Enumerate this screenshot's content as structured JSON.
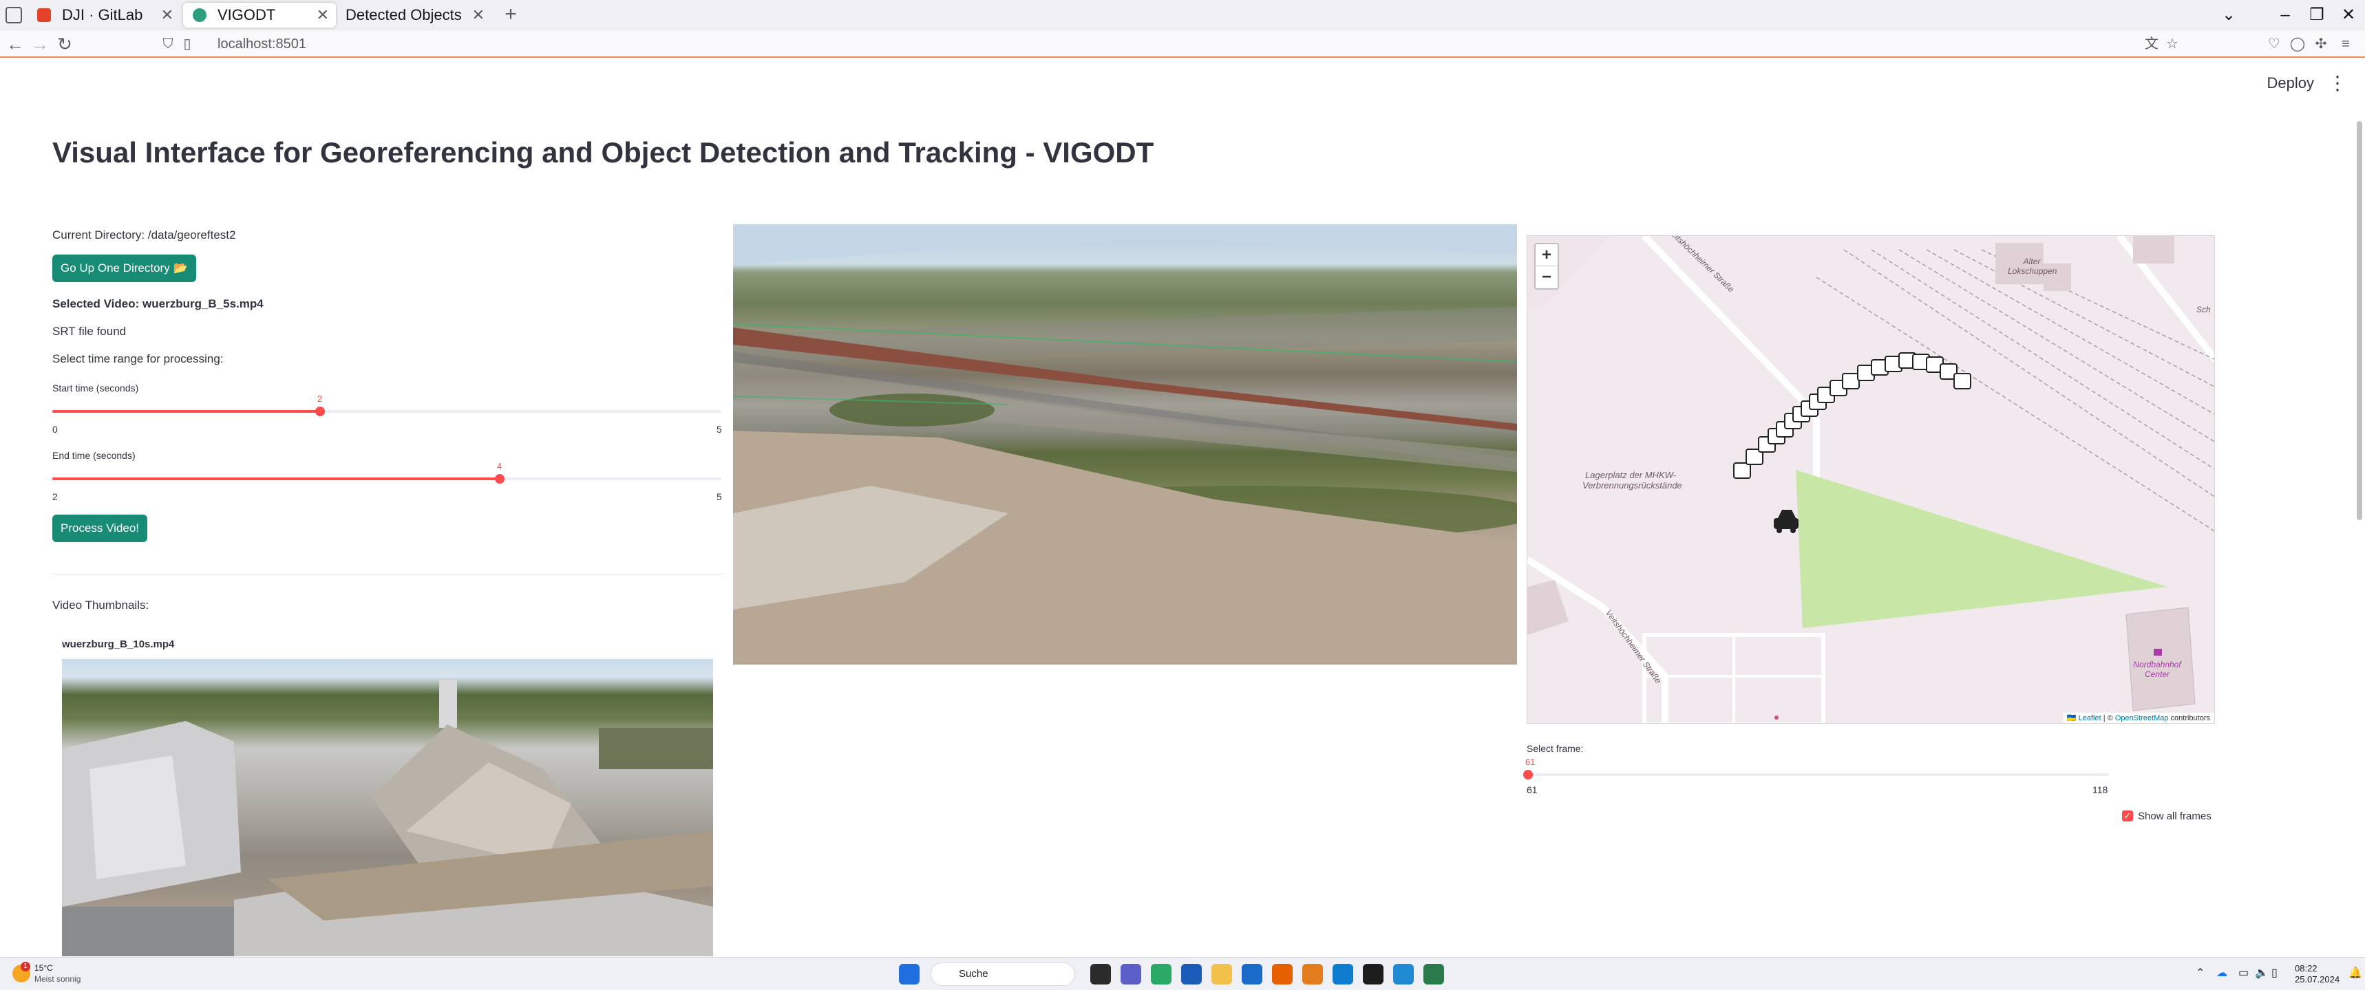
{
  "browser": {
    "tabs": [
      {
        "label": "DJI · GitLab",
        "active": false
      },
      {
        "label": "VIGODT",
        "active": true
      },
      {
        "label": "Detected Objects Map",
        "active": false
      }
    ],
    "url": "localhost:8501"
  },
  "app": {
    "deploy_label": "Deploy",
    "title": "Visual Interface for Georeferencing and Object Detection and Tracking - VIGODT",
    "current_directory": "Current Directory: /data/georeftest2",
    "go_up_button": "Go Up One Directory 📂",
    "selected_video": "Selected Video: wuerzburg_B_5s.mp4",
    "srt_status": "SRT file found",
    "time_range_label": "Select time range for processing:",
    "start_slider": {
      "label": "Start time (seconds)",
      "value": "2",
      "min": "0",
      "max": "5",
      "fraction": 0.4
    },
    "end_slider": {
      "label": "End time (seconds)",
      "value": "4",
      "min": "2",
      "max": "5",
      "fraction": 0.667
    },
    "process_button": "Process Video!",
    "thumbnails_label": "Video Thumbnails:",
    "thumbnail_name": "wuerzburg_B_10s.mp4",
    "frame_slider": {
      "label": "Select frame:",
      "value": "61",
      "min": "61",
      "max": "118",
      "fraction": 0.0
    },
    "show_all_frames": {
      "label": "Show all frames",
      "checked": true
    }
  },
  "map": {
    "labels": {
      "street_top": "Veitshöchheimer Straße",
      "lokschuppen": "Alter Lokschuppen",
      "lagerplatz": "Lagerplatz der MHKW-Verbrennungsrückstände",
      "street_bottom": "Veitshöchheimer Straße",
      "center": "Nordbahnhof Center",
      "sch": "Sch"
    },
    "attribution": {
      "leaflet": "🇺🇦 Leaflet",
      "sep": " | © ",
      "osm": "OpenStreetMap",
      "rest": " contributors"
    },
    "zoom_in": "+",
    "zoom_out": "−"
  },
  "taskbar": {
    "weather_temp": "15°C",
    "weather_desc": "Meist sonnig",
    "weather_badge": "1",
    "search": "Suche",
    "time": "08:22",
    "date": "25.07.2024"
  },
  "colors": {
    "accent": "#ff4b4b",
    "button": "#178b74",
    "park": "#c8e6a6"
  }
}
